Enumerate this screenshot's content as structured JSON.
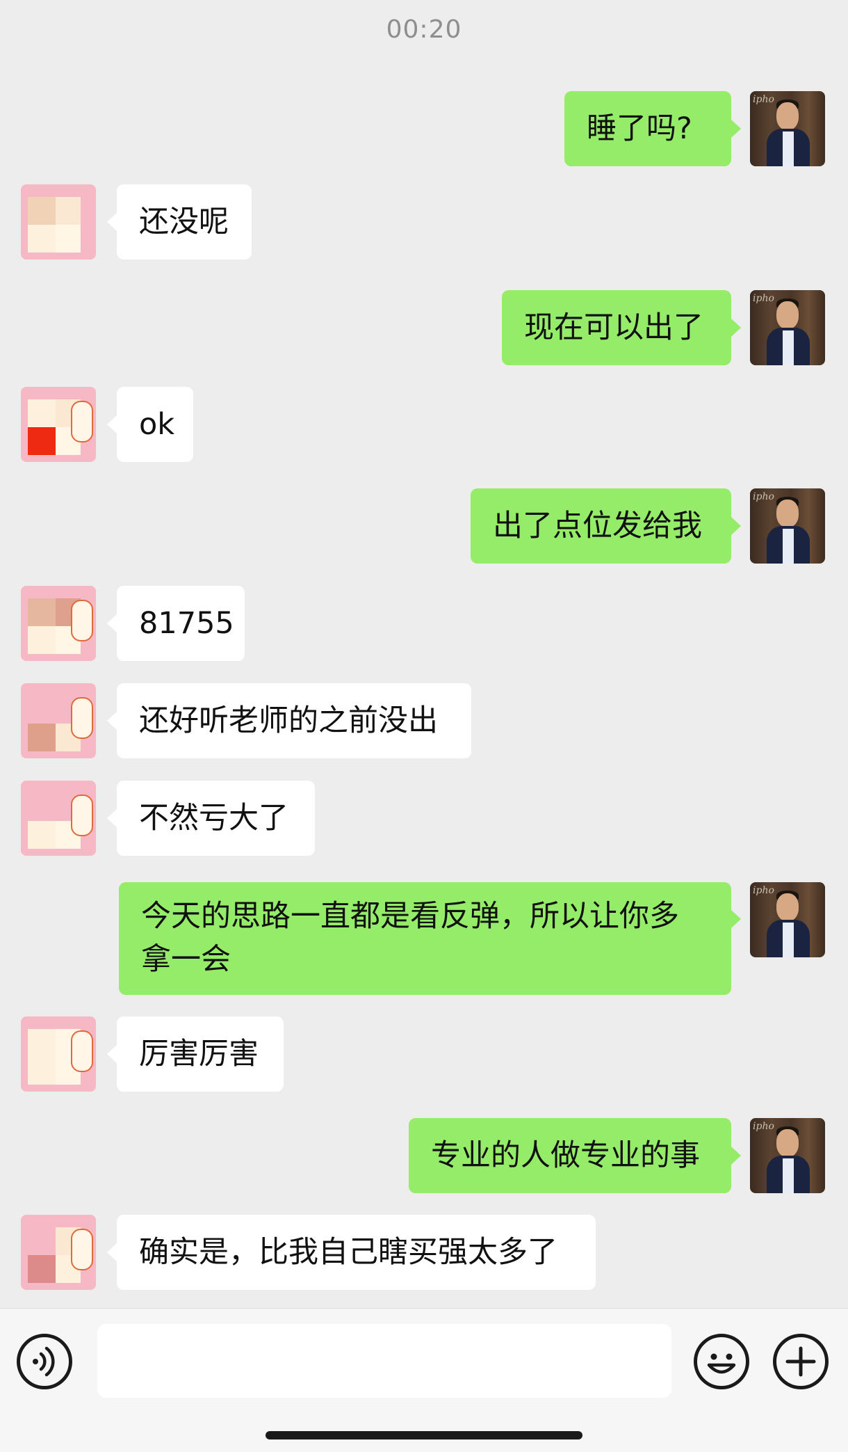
{
  "timestamp": "00:20",
  "messages": [
    {
      "side": "out",
      "text": "睡了吗?"
    },
    {
      "side": "in",
      "text": "还没呢"
    },
    {
      "side": "out",
      "text": "现在可以出了"
    },
    {
      "side": "in",
      "text": "ok"
    },
    {
      "side": "out",
      "text": "出了点位发给我"
    },
    {
      "side": "in",
      "text": "81755"
    },
    {
      "side": "in",
      "text": "还好听老师的之前没出"
    },
    {
      "side": "in",
      "text": "不然亏大了"
    },
    {
      "side": "out",
      "line1": "今天的思路一直都是看反弹，所以让你多",
      "line2": "拿一会"
    },
    {
      "side": "in",
      "text": "厉害厉害"
    },
    {
      "side": "out",
      "text": "专业的人做专业的事"
    },
    {
      "side": "in",
      "text": "确实是，比我自己瞎买强太多了"
    }
  ],
  "my_avatar_caption": "ipho",
  "input": {
    "value": ""
  },
  "icons": {
    "voice": "voice-mode-icon",
    "emoji": "emoji-icon",
    "plus": "plus-icon"
  }
}
